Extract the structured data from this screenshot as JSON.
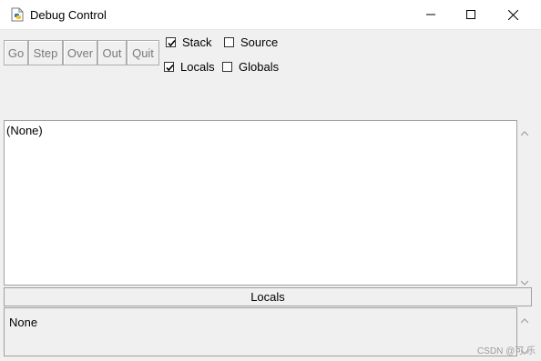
{
  "window": {
    "title": "Debug Control",
    "controls": [
      "minimize-icon",
      "maximize-icon",
      "close-icon"
    ]
  },
  "toolbar": {
    "buttons": [
      {
        "label": "Go"
      },
      {
        "label": "Step"
      },
      {
        "label": "Over"
      },
      {
        "label": "Out"
      },
      {
        "label": "Quit"
      }
    ]
  },
  "options": {
    "stack": {
      "label": "Stack",
      "checked": true
    },
    "source": {
      "label": "Source",
      "checked": false
    },
    "locals": {
      "label": "Locals",
      "checked": true
    },
    "globals": {
      "label": "Globals",
      "checked": false
    }
  },
  "stack_panel": {
    "text": "(None)"
  },
  "locals_panel": {
    "header": "Locals",
    "text": "None"
  },
  "watermark": "CSDN @可 乐"
}
